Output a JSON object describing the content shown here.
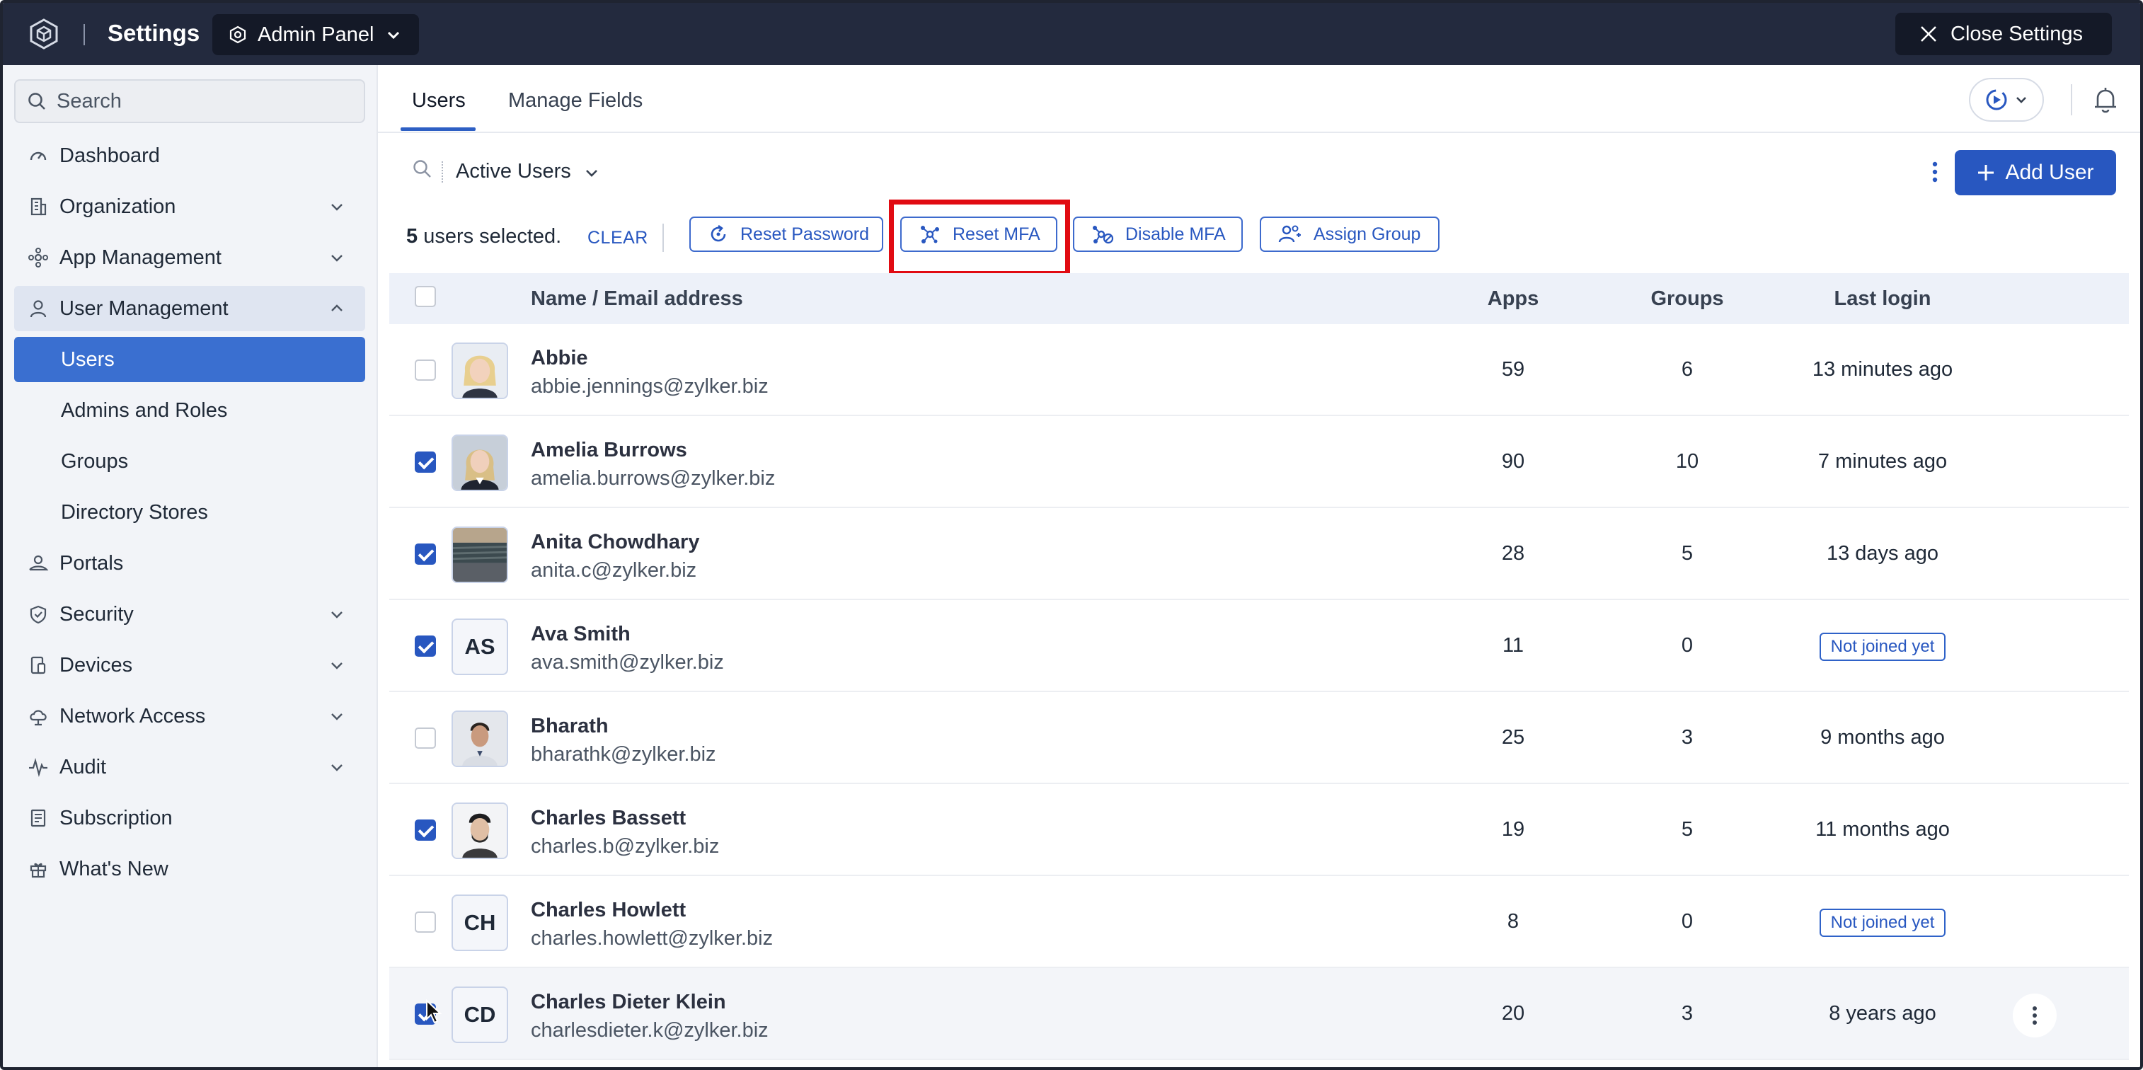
{
  "header": {
    "app_title": "Settings",
    "panel_switch_label": "Admin Panel",
    "close_label": "Close Settings",
    "bg_color": "#232a3e"
  },
  "sidebar": {
    "search_placeholder": "Search",
    "items": [
      {
        "label": "Dashboard",
        "icon": "gauge-icon"
      },
      {
        "label": "Organization",
        "icon": "building-icon",
        "chevron": "down"
      },
      {
        "label": "App Management",
        "icon": "apps-icon",
        "chevron": "down"
      },
      {
        "label": "User Management",
        "icon": "user-icon",
        "chevron": "up",
        "expanded": true
      },
      {
        "label": "Users",
        "sub": true,
        "active": true
      },
      {
        "label": "Admins and Roles",
        "sub": true
      },
      {
        "label": "Groups",
        "sub": true
      },
      {
        "label": "Directory Stores",
        "sub": true
      },
      {
        "label": "Portals",
        "icon": "portal-icon"
      },
      {
        "label": "Security",
        "icon": "shield-icon",
        "chevron": "down"
      },
      {
        "label": "Devices",
        "icon": "devices-icon",
        "chevron": "down"
      },
      {
        "label": "Network Access",
        "icon": "cloud-icon",
        "chevron": "down"
      },
      {
        "label": "Audit",
        "icon": "pulse-icon",
        "chevron": "down"
      },
      {
        "label": "Subscription",
        "icon": "receipt-icon"
      },
      {
        "label": "What's New",
        "icon": "gift-icon"
      }
    ]
  },
  "tabs": [
    {
      "label": "Users",
      "active": true
    },
    {
      "label": "Manage Fields",
      "active": false
    }
  ],
  "filter": {
    "label": "Active Users"
  },
  "toolbar": {
    "add_user_label": "Add User",
    "accent_color": "#2857c0"
  },
  "selection": {
    "count": "5",
    "suffix": " users selected.",
    "clear_label": "CLEAR",
    "actions": [
      {
        "label": "Reset Password",
        "icon": "refresh-icon"
      },
      {
        "label": "Reset MFA",
        "icon": "nodes-icon",
        "highlighted": true
      },
      {
        "label": "Disable MFA",
        "icon": "disable-mfa-icon"
      },
      {
        "label": "Assign Group",
        "icon": "user-group-icon"
      }
    ]
  },
  "table": {
    "columns": [
      "Name / Email address",
      "Apps",
      "Groups",
      "Last login"
    ],
    "rows": [
      {
        "name": "Abbie",
        "email": "abbie.jennings@zylker.biz",
        "apps": "59",
        "groups": "6",
        "last_login": "13 minutes ago",
        "checked": false,
        "avatar": "photo"
      },
      {
        "name": "Amelia Burrows",
        "email": "amelia.burrows@zylker.biz",
        "apps": "90",
        "groups": "10",
        "last_login": "7 minutes ago",
        "checked": true,
        "avatar": "photo"
      },
      {
        "name": "Anita Chowdhary",
        "email": "anita.c@zylker.biz",
        "apps": "28",
        "groups": "5",
        "last_login": "13 days ago",
        "checked": true,
        "avatar": "photo"
      },
      {
        "name": "Ava Smith",
        "email": "ava.smith@zylker.biz",
        "apps": "11",
        "groups": "0",
        "last_login": "Not joined yet",
        "checked": true,
        "avatar": "AS",
        "badge": true
      },
      {
        "name": "Bharath",
        "email": "bharathk@zylker.biz",
        "apps": "25",
        "groups": "3",
        "last_login": "9 months ago",
        "checked": false,
        "avatar": "photo"
      },
      {
        "name": "Charles Bassett",
        "email": "charles.b@zylker.biz",
        "apps": "19",
        "groups": "5",
        "last_login": "11 months ago",
        "checked": true,
        "avatar": "photo"
      },
      {
        "name": "Charles Howlett",
        "email": "charles.howlett@zylker.biz",
        "apps": "8",
        "groups": "0",
        "last_login": "Not joined yet",
        "checked": false,
        "avatar": "CH",
        "badge": true
      },
      {
        "name": "Charles Dieter Klein",
        "email": "charlesdieter.k@zylker.biz",
        "apps": "20",
        "groups": "3",
        "last_login": "8 years ago",
        "checked": true,
        "avatar": "CD",
        "hover": true
      }
    ]
  }
}
